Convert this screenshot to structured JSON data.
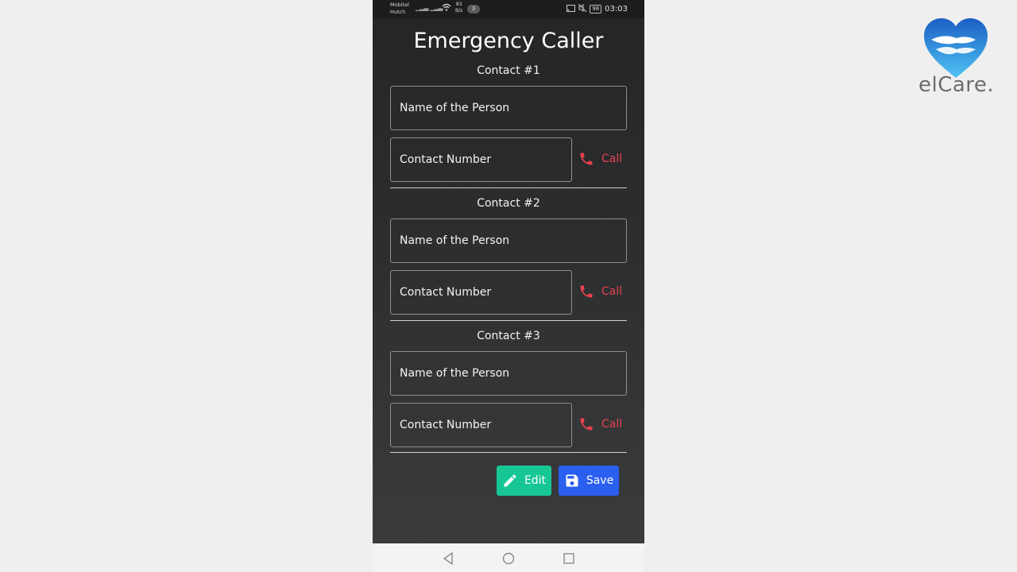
{
  "status_bar": {
    "carrier_line1": "Mobitel",
    "carrier_line2": "Hutch",
    "net_speed_value": "83",
    "net_speed_unit": "B/s",
    "notification_count": "3",
    "battery": "98",
    "time": "03:03"
  },
  "app": {
    "title": "Emergency Caller"
  },
  "contacts": [
    {
      "label": "Contact #1",
      "name_placeholder": "Name of the Person",
      "number_placeholder": "Contact Number",
      "call_label": "Call"
    },
    {
      "label": "Contact #2",
      "name_placeholder": "Name of the Person",
      "number_placeholder": "Contact Number",
      "call_label": "Call"
    },
    {
      "label": "Contact #3",
      "name_placeholder": "Name of the Person",
      "number_placeholder": "Contact Number",
      "call_label": "Call"
    }
  ],
  "actions": {
    "edit_label": "Edit",
    "save_label": "Save"
  },
  "logo": {
    "text": "elCare."
  },
  "colors": {
    "call_red": "#e8414f",
    "edit_green": "#16c794",
    "save_blue": "#2a5ff0",
    "logo_blue": "#2f7fd9"
  }
}
